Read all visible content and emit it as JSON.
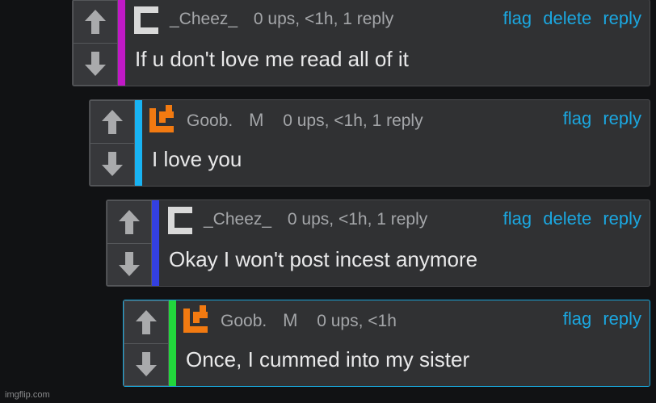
{
  "comments": [
    {
      "username": "_Cheez_",
      "badge": "",
      "meta": "0 ups, <1h, 1 reply",
      "actions": [
        "flag",
        "delete",
        "reply"
      ],
      "text": "If u don't love me read all of it",
      "color": "#c119c6",
      "avatar": "white-bracket-icon"
    },
    {
      "username": "Goob.",
      "badge": "M",
      "meta": "0 ups, <1h, 1 reply",
      "actions": [
        "flag",
        "reply"
      ],
      "text": "I love you",
      "color": "#18b3f3",
      "avatar": "orange-bracket-icon"
    },
    {
      "username": "_Cheez_",
      "badge": "",
      "meta": "0 ups, <1h, 1 reply",
      "actions": [
        "flag",
        "delete",
        "reply"
      ],
      "text": "Okay I won't post incest anymore",
      "color": "#3340e0",
      "avatar": "white-bracket-icon"
    },
    {
      "username": "Goob.",
      "badge": "M",
      "meta": "0 ups, <1h",
      "actions": [
        "flag",
        "reply"
      ],
      "text": "Once, I cummed into my sister",
      "color": "#22d63c",
      "avatar": "orange-bracket-icon"
    }
  ],
  "watermark": "imgflip.com"
}
